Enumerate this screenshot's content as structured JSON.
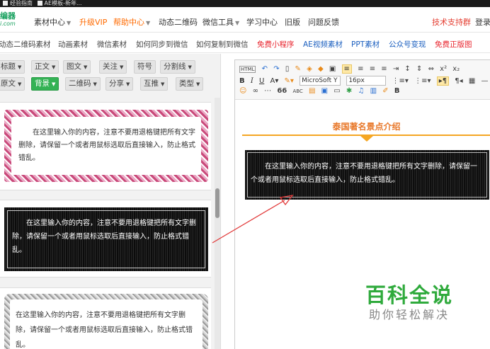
{
  "bookmarks": [
    "经验指南",
    "AE模板-新年..."
  ],
  "logo": {
    "line1": "编器",
    "line2": "i.com"
  },
  "nav": {
    "items": [
      {
        "label": "素材中心",
        "caret": "▼"
      },
      {
        "label": "升级VIP"
      },
      {
        "label": "帮助中心",
        "caret": "▼"
      },
      {
        "label": "动态二维码"
      },
      {
        "label": "微信工具",
        "caret": "▼"
      },
      {
        "label": "学习中心"
      },
      {
        "label": "旧版"
      },
      {
        "label": "问题反馈"
      }
    ],
    "right": [
      "技术支持群",
      "登录"
    ]
  },
  "subnav": [
    "动态二维码素材",
    "动画素材",
    "微信素材",
    "如何同步到微信",
    "如何复制到微信",
    "免费小程序",
    "AE视频素材",
    "PPT素材",
    "公众号变现",
    "免费正版图"
  ],
  "categories": {
    "row1": [
      "标题",
      "正文",
      "图文",
      "关注",
      "符号",
      "分割线"
    ],
    "row2": [
      "原文",
      "背景",
      "二维码",
      "分享",
      "互推",
      "类型"
    ]
  },
  "templates": {
    "text": "在这里输入你的内容，注意不要用退格键把所有文字删除，请保留一个或者用鼠标选取后直接输入，防止格式错乱。"
  },
  "editor": {
    "toolbar": {
      "row1": {
        "html": "HTML",
        "font": "MicroSoft Y",
        "size": "16px",
        "sup": "x²",
        "sub": "x₂",
        "omega": "Ω"
      },
      "row2": {
        "bold": "B",
        "italic": "I",
        "underline": "U",
        "fontcolor": "A"
      },
      "row3": {
        "quote": "66",
        "abc": "ABC",
        "bold2": "B"
      }
    },
    "heading": "泰国著名景点介绍",
    "body_text": "在这里输入你的内容，注意不要用退格键把所有文字删除，请保留一个或者用鼠标选取后直接输入，防止格式错乱。"
  },
  "watermark": {
    "main": "百科全说",
    "sub": "助你轻松解决"
  },
  "colors": {
    "accent_green": "#33b254",
    "nav_orange": "#ff6a00",
    "heading_orange": "#e8782a",
    "watermark_green": "#2faa3c",
    "arrow_red": "#e23b3b"
  }
}
